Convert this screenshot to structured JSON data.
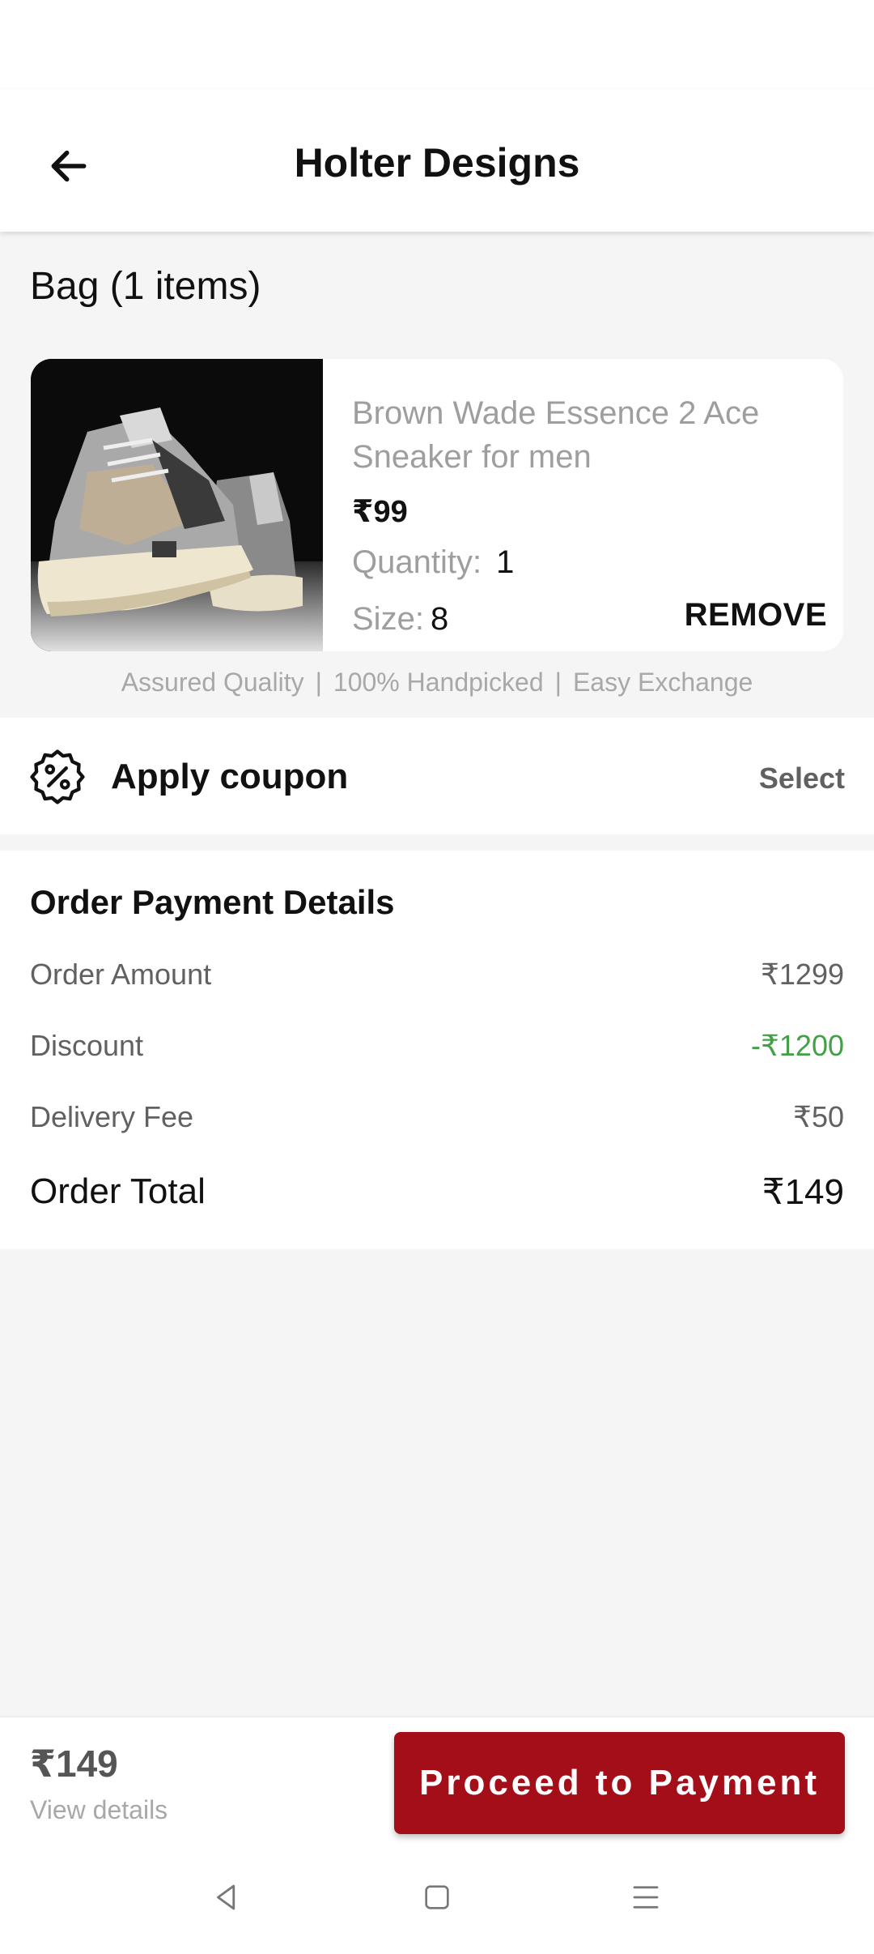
{
  "header": {
    "title": "Holter Designs",
    "back_icon": "arrow-left-icon"
  },
  "bag": {
    "title": "Bag (1 items)"
  },
  "product": {
    "name": "Brown Wade Essence 2 Ace Sneaker for men",
    "price": "₹99",
    "quantity_label": "Quantity:",
    "quantity_value": "1",
    "size_label": "Size:",
    "size_value": "8",
    "remove_label": "REMOVE",
    "image_icon": "sneaker-image"
  },
  "assurance": {
    "items": [
      "Assured Quality",
      "100% Handpicked",
      "Easy Exchange"
    ],
    "separator": "|"
  },
  "coupon": {
    "label": "Apply coupon",
    "action": "Select",
    "icon": "discount-badge-icon"
  },
  "payment": {
    "heading": "Order Payment Details",
    "rows": [
      {
        "label": "Order Amount",
        "value": "₹1299"
      },
      {
        "label": "Discount",
        "value": "-₹1200"
      },
      {
        "label": "Delivery Fee",
        "value": "₹50"
      }
    ],
    "total_label": "Order Total",
    "total_value": "₹149"
  },
  "bottom": {
    "total": "₹149",
    "view_details": "View details",
    "button_label": "Proceed to Payment"
  },
  "colors": {
    "accent": "#a30e18",
    "discount": "#43a047",
    "muted_text": "#9e9e9e"
  },
  "navbar": {
    "icons": [
      "back-triangle-icon",
      "home-square-icon",
      "menu-lines-icon"
    ]
  }
}
